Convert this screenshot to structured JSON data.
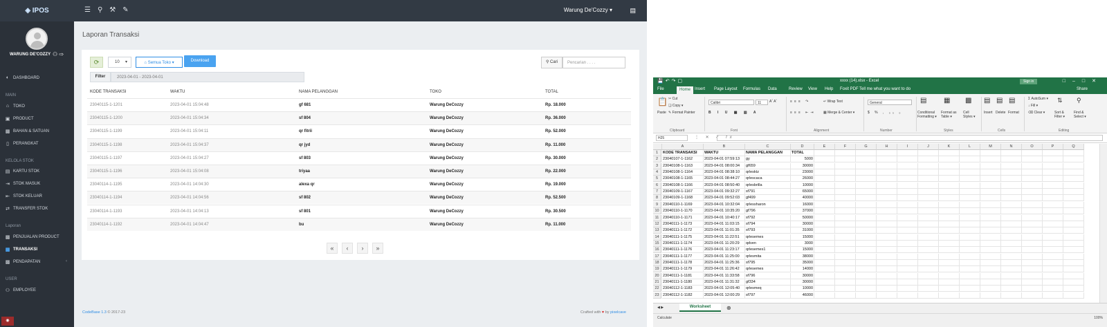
{
  "pos": {
    "logo": "IPOS",
    "topbar": {
      "user": "Warung De'Cozzy ▾"
    },
    "sidebar": {
      "user": "WARUNG DE'COZZY",
      "groups": {
        "main": "MAIN",
        "kelola": "KELOLA STOK",
        "laporan": "Laporan",
        "user": "USER"
      },
      "items": {
        "dashboard": "DASHBOARD",
        "toko": "TOKO",
        "product": "PRODUCT",
        "bahan": "BAHAN & SATUAN",
        "perangkat": "PERANGKAT",
        "kartu": "KARTU STOK",
        "masuk": "STOK MASUK",
        "keluar": "STOK KELUAR",
        "transfer": "TRANSFER STOK",
        "penjualan": "PENJUALAN PRODUCT",
        "transaksi": "TRANSAKSI",
        "pendapatan": "PENDAPATAN",
        "employee": "EMPLOYEE"
      }
    },
    "page_title": "Laporan Transaksi",
    "toolbar": {
      "page_size": "10",
      "store_filter": "Semua Toko ▾",
      "download": "Download",
      "search_button": "Cari",
      "search_placeholder": "Pencarian . . . ."
    },
    "filter": {
      "label": "Filter",
      "range": "2023-04-01 - 2023-04-01"
    },
    "table": {
      "headers": [
        "KODE TRANSAKSI",
        "WAKTU",
        "NAMA PELANGGAN",
        "TOKO",
        "TOTAL"
      ],
      "rows": [
        [
          "23040115-1-1201",
          "2023-04-01 15:04:48",
          "gf 681",
          "Warung DeCozzy",
          "Rp. 18.000"
        ],
        [
          "23040115-1-1200",
          "2023-04-01 15:04:34",
          "sf 804",
          "Warung DeCozzy",
          "Rp. 36.000"
        ],
        [
          "23040115-1-1199",
          "2023-04-01 15:04:11",
          "qr fitrii",
          "Warung DeCozzy",
          "Rp. 52.000"
        ],
        [
          "23040115-1-1198",
          "2023-04-01 15:04:37",
          "qr jyd",
          "Warung DeCozzy",
          "Rp. 11.000"
        ],
        [
          "23040115-1-1197",
          "2023-04-01 15:04:27",
          "sf 803",
          "Warung DeCozzy",
          "Rp. 30.000"
        ],
        [
          "23040115-1-1196",
          "2023-04-01 15:04:08",
          "triyaa",
          "Warung DeCozzy",
          "Rp. 22.000"
        ],
        [
          "23040114-1-1195",
          "2023-04-01 14:04:30",
          "alexa qr",
          "Warung DeCozzy",
          "Rp. 19.000"
        ],
        [
          "23040114-1-1194",
          "2023-04-01 14:04:56",
          "sf 802",
          "Warung DeCozzy",
          "Rp. 52.500"
        ],
        [
          "23040114-1-1193",
          "2023-04-01 14:04:13",
          "sf 801",
          "Warung DeCozzy",
          "Rp. 30.500"
        ],
        [
          "23040114-1-1192",
          "2023-04-01 14:04:47",
          "bu",
          "Warung DeCozzy",
          "Rp. 11.000"
        ]
      ]
    },
    "pager": {
      "first": "«",
      "prev": "‹",
      "next": "›",
      "last": "»"
    },
    "footer": {
      "brand": "CodeBase 1.3",
      "copy": " © 2017-23",
      "crafted": "Crafted with",
      "by": " by ",
      "author": "pixelcave"
    }
  },
  "excel": {
    "title": "xxxx (14).xlsx - Excel",
    "sign_in": "Sign in",
    "tabs": [
      "File",
      "Home",
      "Insert",
      "Page Layout",
      "Formulas",
      "Data",
      "Review",
      "View",
      "Help",
      "Foxit PDF",
      "Tell me what you want to do"
    ],
    "share": "Share",
    "ribbon": {
      "paste": "Paste",
      "cut": "Cut",
      "copy": "Copy ▾",
      "format_painter": "Format Painter",
      "font_name": "Calibri",
      "font_size": "11",
      "wrap": "Wrap Text",
      "merge": "Merge & Center ▾",
      "number_format": "General",
      "conditional": "Conditional Formatting ▾",
      "format_table": "Format as Table ▾",
      "cell_styles": "Cell Styles ▾",
      "insert": "Insert",
      "delete": "Delete",
      "format": "Format",
      "autosum": "AutoSum ▾",
      "fill": "Fill ▾",
      "clear": "Clear ▾",
      "sort": "Sort & Filter ▾",
      "find": "Find & Select ▾",
      "groups": [
        "Clipboard",
        "Font",
        "Alignment",
        "Number",
        "Styles",
        "Cells",
        "Editing"
      ]
    },
    "namebox": "H25",
    "columns": [
      "A",
      "B",
      "C",
      "D",
      "E",
      "F",
      "G",
      "H",
      "I",
      "J",
      "K",
      "L",
      "M",
      "N",
      "O",
      "P",
      "Q"
    ],
    "rows": [
      [
        "KODE TRANSAKSI",
        "WAKTU",
        "NAMA PELANGGAN",
        "TOTAL"
      ],
      [
        "23040107-1-1162",
        "2023-04-01 07:59:13",
        "gy",
        "5000"
      ],
      [
        "23040108-1-1163",
        "2023-04-01 08:00:34",
        "gf659",
        "30000"
      ],
      [
        "23040108-1-1164",
        "2023-04-01 08:38:10",
        "qrlesktz",
        "23000"
      ],
      [
        "23040108-1-1165",
        "2023-04-01 08:44:27",
        "qrlescaca",
        "26000"
      ],
      [
        "23040108-1-1166",
        "2023-04-01 08:50:40",
        "qrlesbrilla",
        "10000"
      ],
      [
        "23040109-1-1167",
        "2023-04-01 09:32:27",
        "sf791",
        "65000"
      ],
      [
        "23040109-1-1168",
        "2023-04-01 09:52:03",
        "gf499",
        "40000"
      ],
      [
        "23040110-1-1169",
        "2023-04-01 10:32:04",
        "qrlessharon",
        "16000"
      ],
      [
        "23040110-1-1170",
        "2023-04-01 10:35:20",
        "gf796",
        "37000"
      ],
      [
        "23040110-1-1171",
        "2023-04-01 10:40:17",
        "sf792",
        "50000"
      ],
      [
        "23040111-1-1173",
        "2023-04-01 11:03:15",
        "sf794",
        "30000"
      ],
      [
        "23040111-1-1172",
        "2023-04-01 11:01:35",
        "sf793",
        "31000"
      ],
      [
        "23040111-1-1175",
        "2023-04-01 11:22:51",
        "qrlesemes",
        "15000"
      ],
      [
        "23040111-1-1174",
        "2023-04-01 11:20:29",
        "qdven",
        "3000"
      ],
      [
        "23040111-1-1176",
        "2023-04-01 11:23:17",
        "qrlesemes1",
        "15000"
      ],
      [
        "23040111-1-1177",
        "2023-04-01 11:25:00",
        "qrlesmita",
        "38000"
      ],
      [
        "23040111-1-1178",
        "2023-04-01 11:25:36",
        "sf795",
        "35000"
      ],
      [
        "23040111-1-1179",
        "2023-04-01 11:26:42",
        "qrlesemes",
        "14000"
      ],
      [
        "23040111-1-1181",
        "2023-04-01 11:33:58",
        "sf796",
        "30000"
      ],
      [
        "23040111-1-1180",
        "2023-04-01 11:31:32",
        "gf334",
        "30000"
      ],
      [
        "23040112-1-1183",
        "2023-04-01 12:05:40",
        "qrlesmeq",
        "10000"
      ],
      [
        "23040112-1-1182",
        "2023-04-01 12:00:29",
        "sf797",
        "46000"
      ]
    ],
    "sheet": "Worksheet",
    "status": "Calculate",
    "zoom": "100%"
  }
}
